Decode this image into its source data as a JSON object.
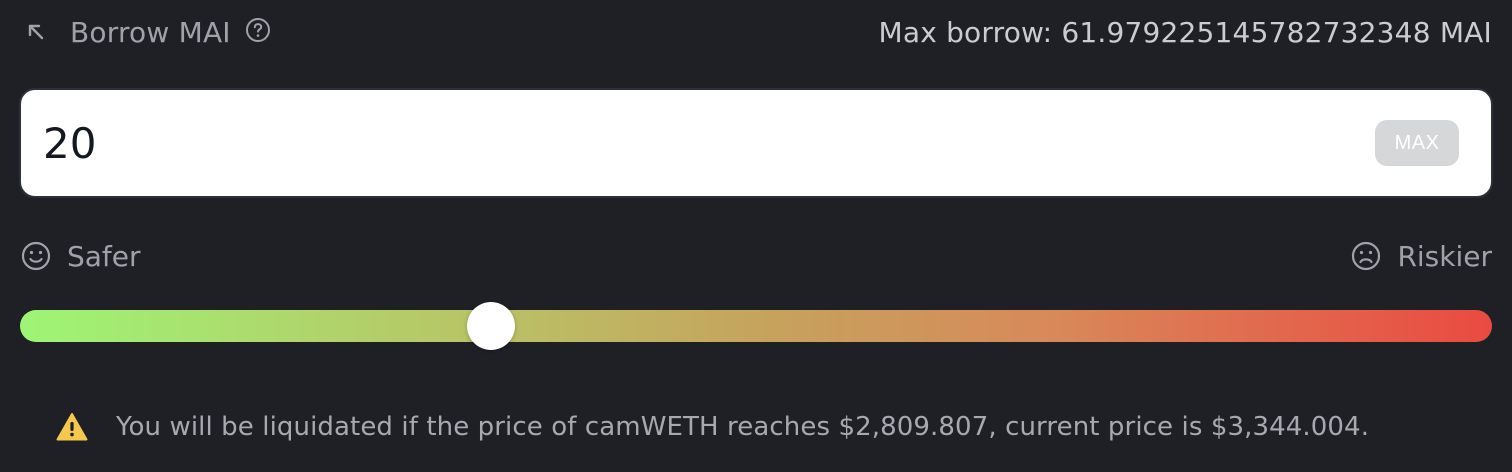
{
  "header": {
    "title": "Borrow MAI",
    "corner_icon": "arrow-up-left-icon",
    "help_icon": "question-circle-icon",
    "max_borrow_text": "Max borrow: 61.979225145782732348 MAI"
  },
  "input": {
    "value": "20",
    "max_label": "MAX"
  },
  "risk": {
    "safer_label": "Safer",
    "safer_icon": "smile-icon",
    "riskier_label": "Riskier",
    "riskier_icon": "frown-icon"
  },
  "slider": {
    "fraction": 0.32,
    "gradient_start": "#9ef575",
    "gradient_end": "#ea4a41"
  },
  "warning": {
    "icon": "warning-triangle-icon",
    "icon_color": "#f5c84b",
    "text": "You will be liquidated if the price of camWETH reaches $2,809.807, current price is $3,344.004."
  },
  "colors": {
    "background": "#1f2026",
    "muted_text": "#9ea2aa"
  }
}
